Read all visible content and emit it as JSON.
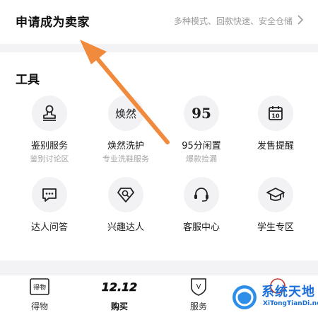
{
  "seller": {
    "title": "申请成为卖家",
    "subtitle": "多种模式、回款快速、安全仓储"
  },
  "tools": {
    "title": "工具",
    "items": [
      {
        "label": "鉴别服务",
        "sublabel": "鉴别讨论区",
        "icon": "authenticate-stamp-icon",
        "glyph": ""
      },
      {
        "label": "焕然洗护",
        "sublabel": "专业洗鞋服务",
        "icon": "huanran-logo-icon",
        "glyph": "焕然"
      },
      {
        "label": "95分闲置",
        "sublabel": "爆款捡漏",
        "icon": "95-logo-icon",
        "glyph": "95"
      },
      {
        "label": "发售提醒",
        "sublabel": "",
        "icon": "calendar-icon",
        "glyph": "10"
      },
      {
        "label": "达人问答",
        "sublabel": "",
        "icon": "chat-bubble-icon",
        "glyph": ""
      },
      {
        "label": "兴趣达人",
        "sublabel": "",
        "icon": "diamond-search-icon",
        "glyph": ""
      },
      {
        "label": "客服中心",
        "sublabel": "",
        "icon": "headset-icon",
        "glyph": ""
      },
      {
        "label": "学生专区",
        "sublabel": "",
        "icon": "graduation-cap-icon",
        "glyph": ""
      }
    ]
  },
  "tabbar": {
    "items": [
      {
        "label": "得物",
        "icon_text": "得物",
        "active": false
      },
      {
        "label": "购买",
        "icon_text": "12.12",
        "active": true
      },
      {
        "label": "服务",
        "icon_text": "V",
        "active": false
      },
      {
        "label": "",
        "icon_text": "",
        "active": false
      }
    ]
  },
  "watermark": {
    "main": "系统天地",
    "sub": "XiTongTianDi.net"
  },
  "colors": {
    "arrow": "#f08a3c",
    "watermark": "#1b6fd6",
    "icon_bg": "#f2f2f4"
  }
}
